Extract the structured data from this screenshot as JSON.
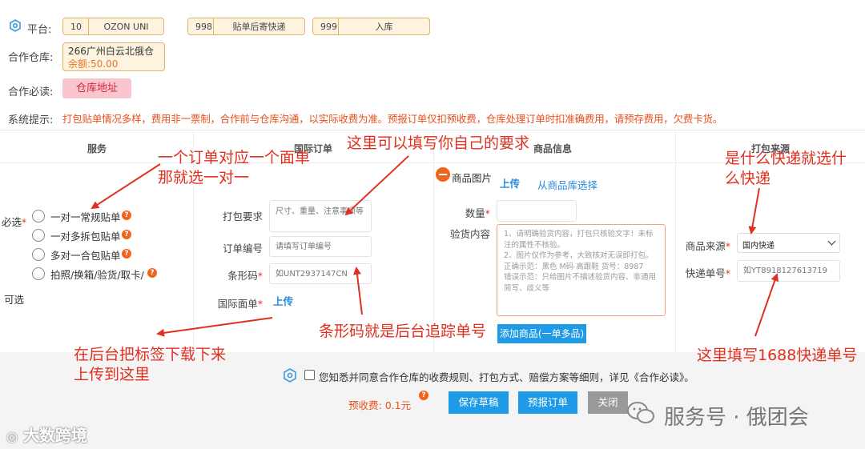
{
  "header": {
    "platform_label": "平台:",
    "platform_chips": [
      {
        "num": "10",
        "text": "OZON UNI"
      },
      {
        "num": "998",
        "text": "贴单后寄快递"
      },
      {
        "num": "999",
        "text": "入库"
      }
    ],
    "warehouse_label": "合作仓库:",
    "warehouse_name": "266广州白云北俄仓",
    "warehouse_balance": "余额:50.00",
    "must_read_label": "合作必读:",
    "must_read_button": "仓库地址",
    "system_label": "系统提示:",
    "system_note": "打包贴单情况多样，费用非一票制，合作前与仓库沟通，以实际收费为准。预报订单仅扣预收费，仓库处理订单时扣准确费用，请预存费用，欠费卡货。"
  },
  "table": {
    "col_service": "服务",
    "col_intl_order": "国际订单",
    "col_product": "商品信息",
    "col_source": "打包来源"
  },
  "service": {
    "required_label": "必选",
    "optional_label": "可选",
    "options": [
      "一对一常规贴单",
      "一对多拆包贴单",
      "多对一合包贴单",
      "拍照/换箱/验货/取卡/"
    ]
  },
  "intl_order": {
    "pack_req_label": "打包要求",
    "pack_req_placeholder": "尺寸、重量、注意事项等",
    "order_no_label": "订单编号",
    "order_no_placeholder": "请填写订单编号",
    "barcode_label": "条形码",
    "barcode_placeholder": "如UNT2937147CN",
    "intl_label_label": "国际面单",
    "intl_label_upload": "上传"
  },
  "product": {
    "image_label": "商品图片",
    "upload": "上传",
    "from_library": "从商品库选择",
    "qty_label": "数量",
    "verify_label": "验货内容",
    "verify_lines": [
      "1、请明确验货内容，打包只核验文字！未标注的属性不核验。",
      "2、图片仅作为参考，大致核对无误即打包。",
      "正确示范：黑色 M码 高跟鞋 货号：8987",
      "错误示范：只给图片不描述验货内容、非通用简写、歧义等"
    ],
    "add_button": "添加商品(一单多品)"
  },
  "source": {
    "source_label": "商品来源",
    "source_value": "国内快递",
    "tracking_label": "快递单号",
    "tracking_placeholder": "如YT8918127613719"
  },
  "footer": {
    "agree_text": "您知悉并同意合作仓库的收费规则、打包方式、赔偿方案等细则，详见《合作必读》。",
    "fee_label": "预收费:",
    "fee_value": "0.1元",
    "save_draft": "保存草稿",
    "submit_order": "预报订单",
    "close": "关闭"
  },
  "annotations": {
    "a1_line1": "一个订单对应一个面单",
    "a1_line2": "那就选一对一",
    "a2": "这里可以填写你自己的要求",
    "a3_line1": "是什么快递就选什",
    "a3_line2": "么快递",
    "a4": "条形码就是后台追踪单号",
    "a5_line1": "在后台把标签下载下来",
    "a5_line2": "上传到这里",
    "a6": "这里填写1688快递单号"
  },
  "watermarks": {
    "right": "服务号 · 俄团会",
    "left": "大数跨境"
  },
  "colors": {
    "annotation_red": "#e03020",
    "primary_blue": "#1f9ae6",
    "warning_orange": "#e8501d",
    "chip_border": "#e0b46a"
  }
}
